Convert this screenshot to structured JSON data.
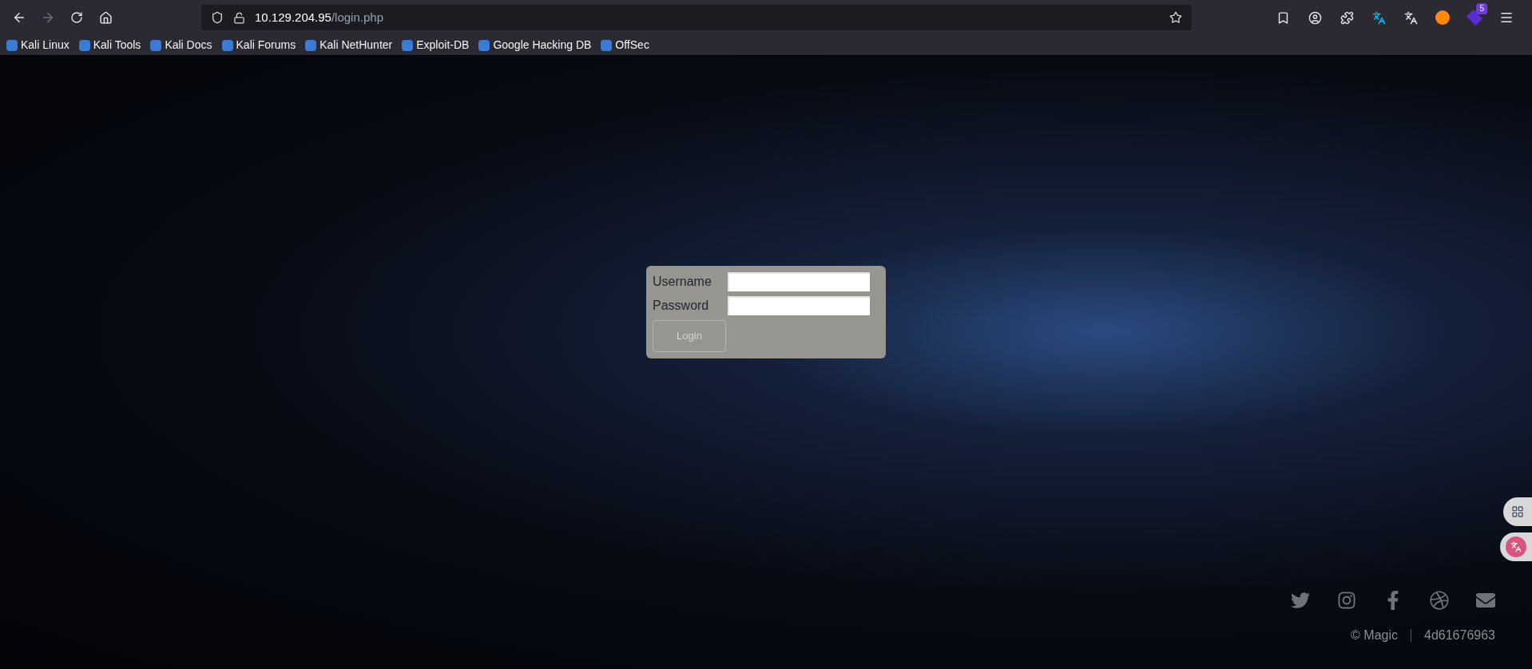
{
  "browser": {
    "url_host": "10.129.204.95",
    "url_path": "/login.php",
    "extension_badge": "5"
  },
  "bookmarks": [
    {
      "label": "Kali Linux"
    },
    {
      "label": "Kali Tools"
    },
    {
      "label": "Kali Docs"
    },
    {
      "label": "Kali Forums"
    },
    {
      "label": "Kali NetHunter"
    },
    {
      "label": "Exploit-DB"
    },
    {
      "label": "Google Hacking DB"
    },
    {
      "label": "OffSec"
    }
  ],
  "login_form": {
    "fields": [
      {
        "label": "Username"
      },
      {
        "label": "Password"
      }
    ],
    "button": "Login"
  },
  "footer": {
    "social": [
      {
        "kind": "twitter"
      },
      {
        "kind": "instagram"
      },
      {
        "kind": "facebook"
      },
      {
        "kind": "dribbble"
      },
      {
        "kind": "email"
      }
    ],
    "copyright": "© Magic",
    "code": "4d61676963"
  }
}
